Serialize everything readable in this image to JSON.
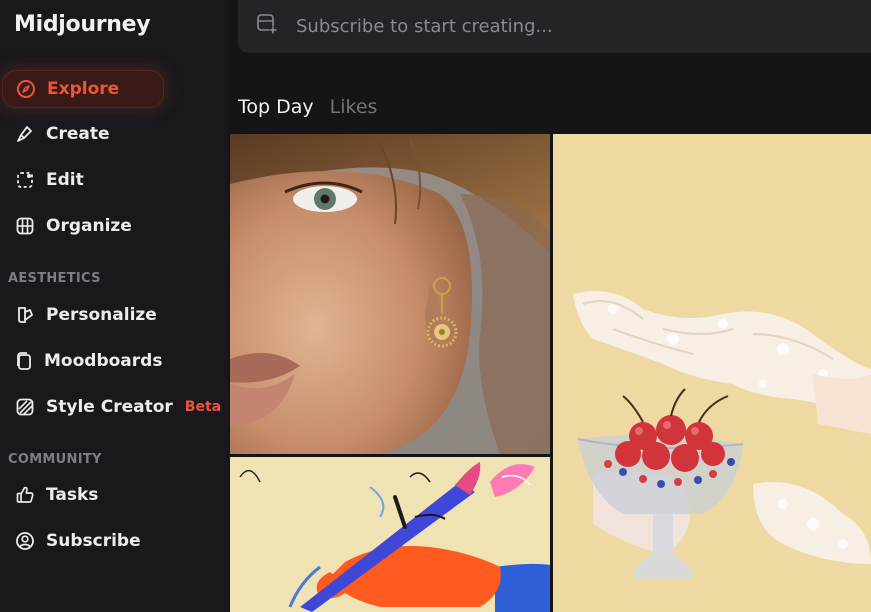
{
  "app": {
    "brand": "Midjourney"
  },
  "sidebar": {
    "items": [
      {
        "label": "Explore",
        "icon": "compass-icon",
        "active": true
      },
      {
        "label": "Create",
        "icon": "brush-icon"
      },
      {
        "label": "Edit",
        "icon": "edit-selection-icon"
      },
      {
        "label": "Organize",
        "icon": "grid-icon"
      }
    ],
    "aesthetics_label": "AESTHETICS",
    "aesthetics_items": [
      {
        "label": "Personalize",
        "icon": "palette-icon"
      },
      {
        "label": "Moodboards",
        "icon": "cards-icon"
      },
      {
        "label": "Style Creator",
        "icon": "stripes-icon",
        "badge": "Beta"
      }
    ],
    "community_label": "COMMUNITY",
    "community_items": [
      {
        "label": "Tasks",
        "icon": "thumbs-up-icon"
      },
      {
        "label": "Subscribe",
        "icon": "user-circle-icon"
      }
    ]
  },
  "search": {
    "placeholder": "Subscribe to start creating..."
  },
  "tabs": {
    "active": "Top Day",
    "inactive": "Likes"
  },
  "gallery": {
    "images": [
      "portrait-woman-earring",
      "gloved-hands-cherries",
      "hand-painting-brush"
    ]
  },
  "colors": {
    "accent": "#f0533b",
    "background": "#151518",
    "sidebar": "#19191d"
  }
}
